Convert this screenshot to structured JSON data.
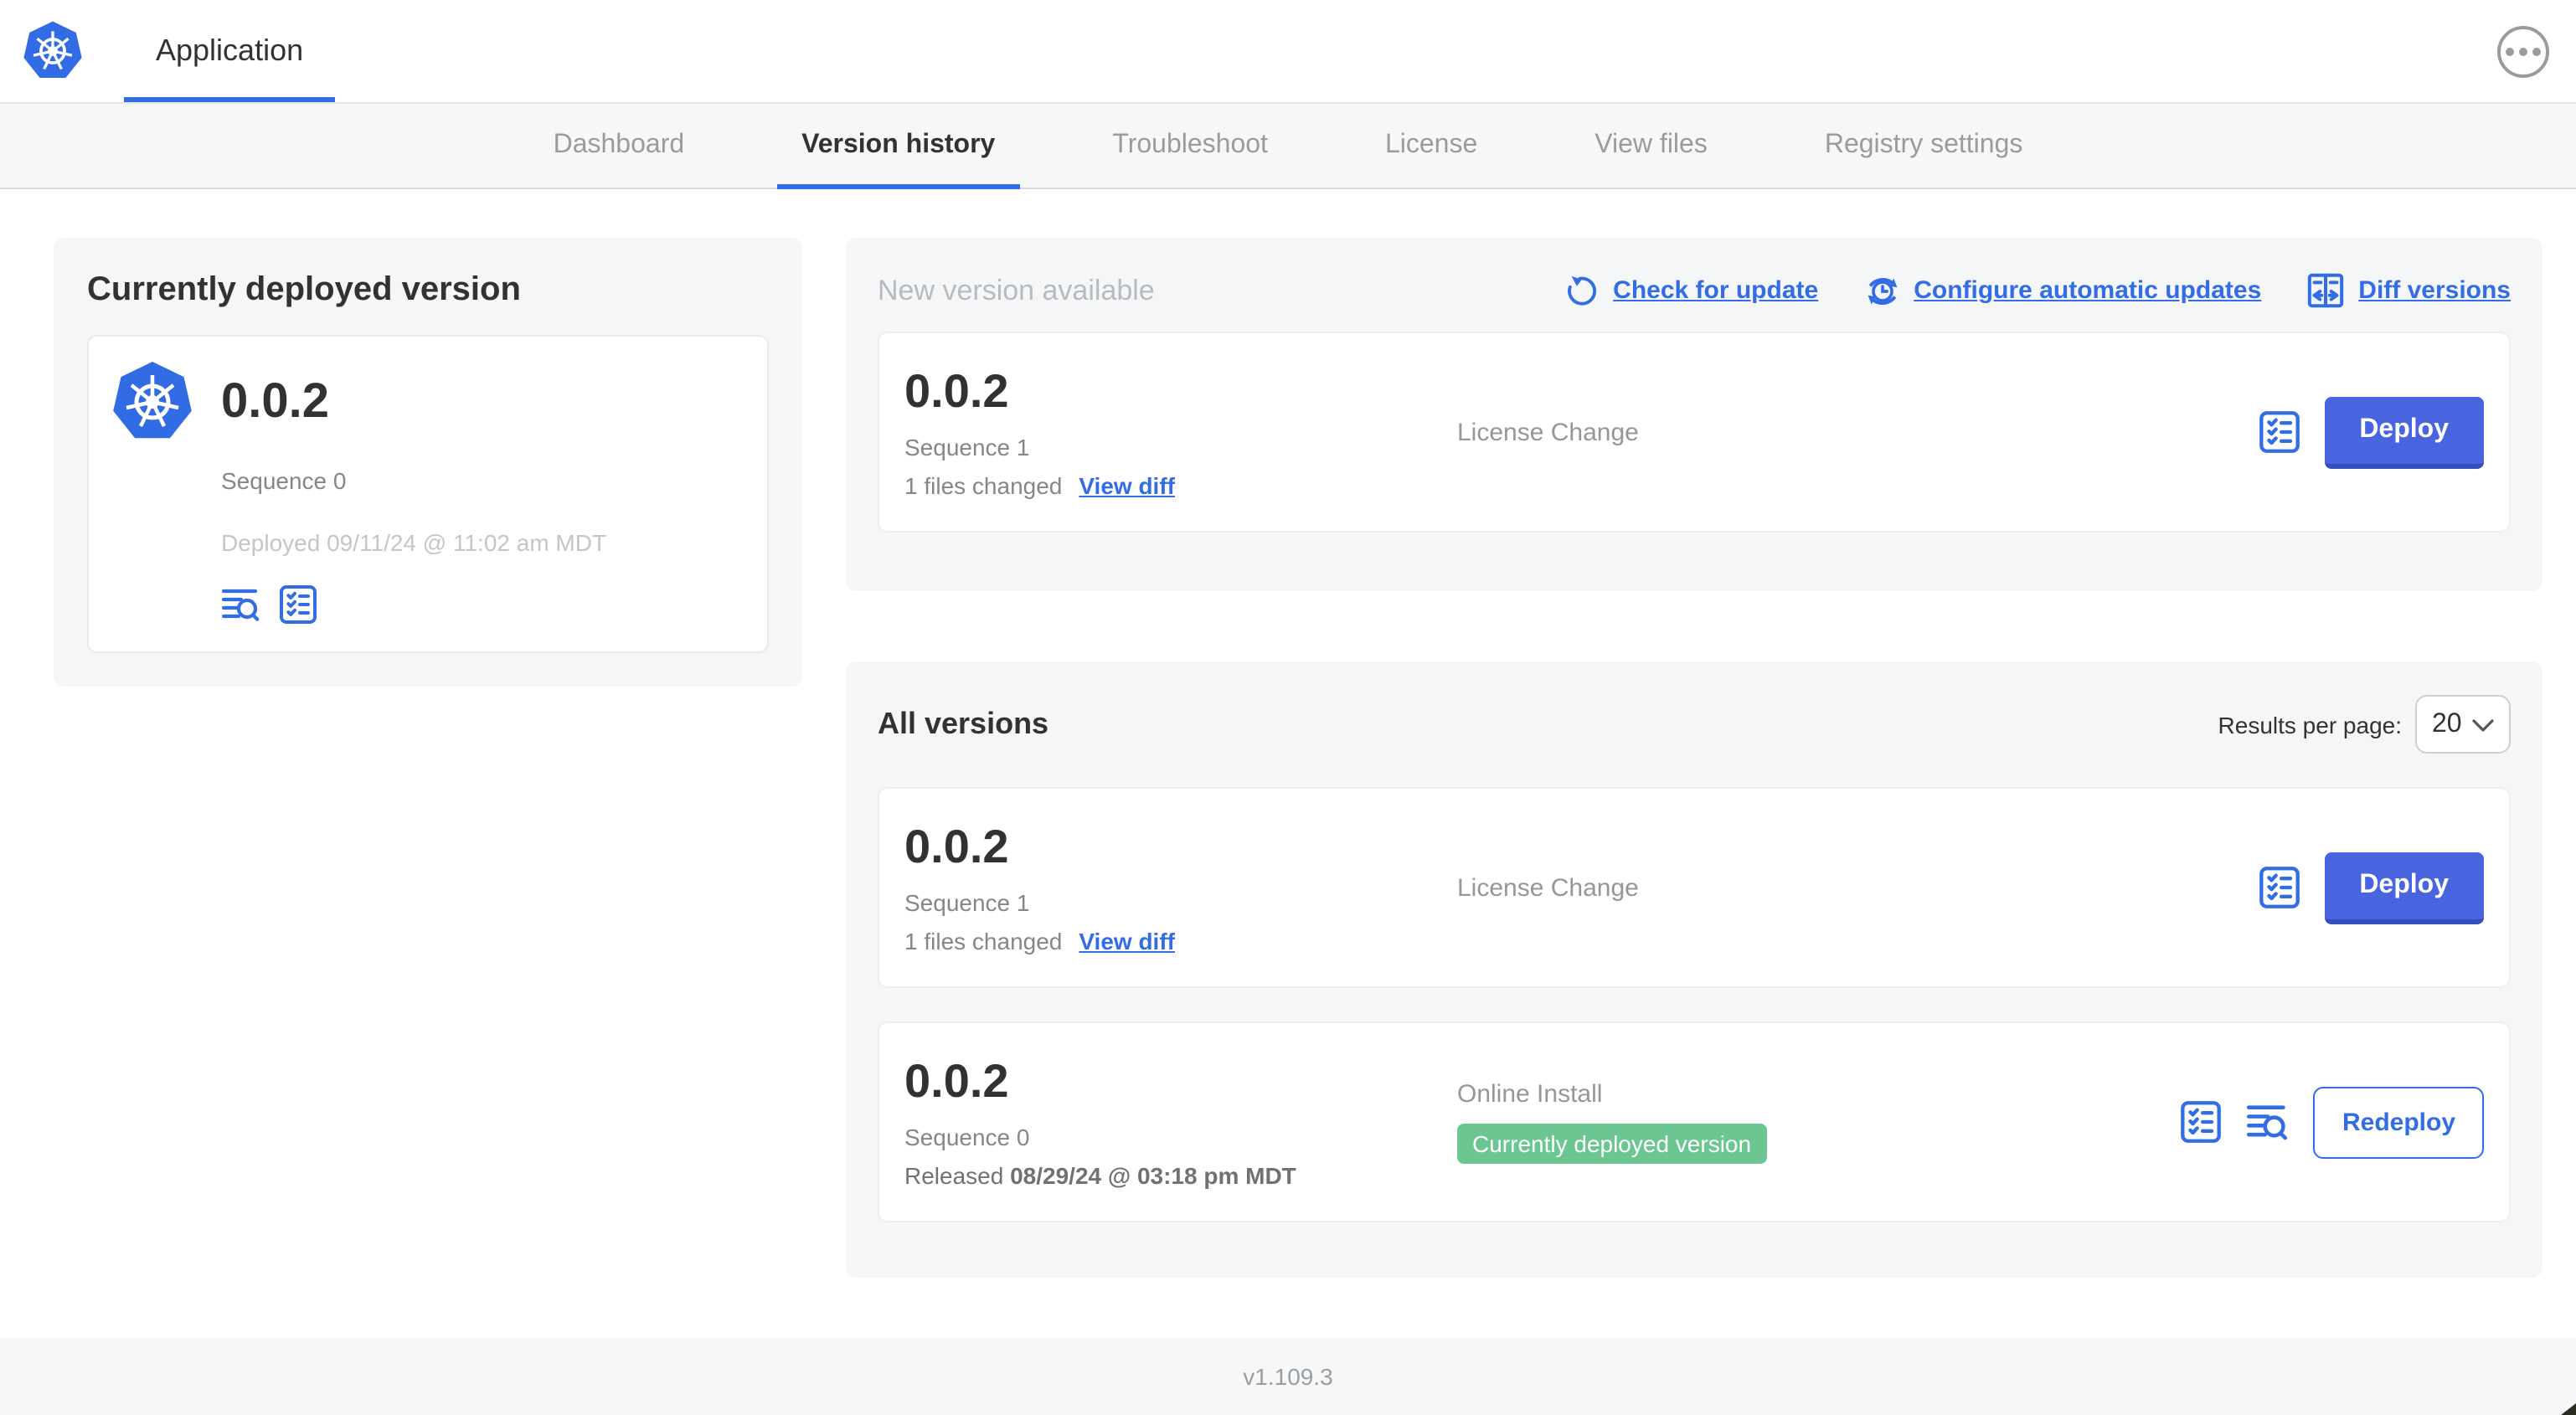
{
  "header": {
    "app_title": "Application"
  },
  "nav": {
    "tabs": [
      {
        "label": "Dashboard",
        "active": false
      },
      {
        "label": "Version history",
        "active": true
      },
      {
        "label": "Troubleshoot",
        "active": false
      },
      {
        "label": "License",
        "active": false
      },
      {
        "label": "View files",
        "active": false
      },
      {
        "label": "Registry settings",
        "active": false
      }
    ]
  },
  "current_version": {
    "title": "Currently deployed version",
    "version": "0.0.2",
    "sequence": "Sequence 0",
    "deployed": "Deployed 09/11/24 @ 11:02 am MDT"
  },
  "new_version": {
    "title": "New version available",
    "links": {
      "check_for_update": "Check for update",
      "configure_automatic_updates": "Configure automatic updates",
      "diff_versions": "Diff versions"
    },
    "row": {
      "version": "0.0.2",
      "sequence": "Sequence 1",
      "files_changed": "1 files changed",
      "view_diff": "View diff",
      "source": "License Change",
      "action": "Deploy"
    }
  },
  "all_versions": {
    "title": "All versions",
    "results_per_page_label": "Results per page:",
    "results_per_page_value": "20",
    "rows": [
      {
        "version": "0.0.2",
        "sequence": "Sequence 1",
        "files_changed": "1 files changed",
        "view_diff": "View diff",
        "source": "License Change",
        "action": "Deploy"
      },
      {
        "version": "0.0.2",
        "sequence": "Sequence 0",
        "released_prefix": "Released ",
        "released_date": "08/29/24 @ 03:18 pm MDT",
        "source": "Online Install",
        "badge": "Currently deployed version",
        "action": "Redeploy"
      }
    ]
  },
  "footer": {
    "version": "v1.109.3"
  },
  "icons": {
    "kubernetes_logo": "kubernetes-helm-wheel",
    "ellipsis": "more-options-dots",
    "refresh": "check-for-update-arrow",
    "clock_refresh": "automatic-updates-clock",
    "diff": "diff-columns-arrows",
    "logs": "lines-with-magnifier",
    "checklist": "preflight-checklist",
    "chevron_down": "select-chevron"
  },
  "colors": {
    "accent_blue": "#326de6",
    "button_blue": "#4864de",
    "badge_green": "#6cc692",
    "panel_gray": "#f5f6f8",
    "text_dark": "#323232",
    "text_gray": "#9b9b9b"
  }
}
